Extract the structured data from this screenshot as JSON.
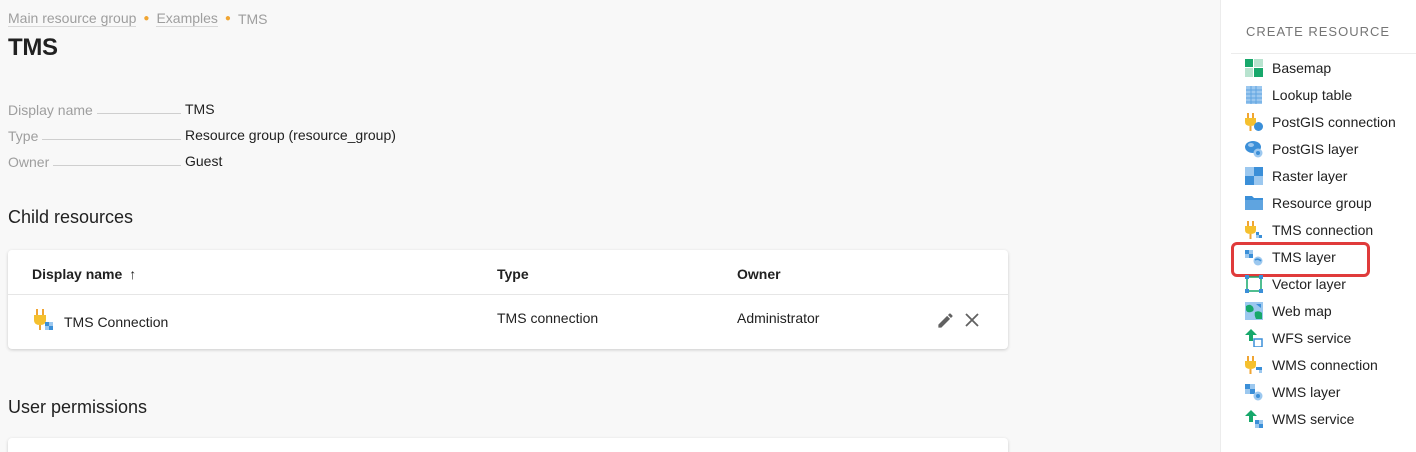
{
  "breadcrumb": [
    "Main resource group",
    "Examples",
    "TMS"
  ],
  "title": "TMS",
  "properties": [
    {
      "key": "Display name",
      "value": "TMS"
    },
    {
      "key": "Type",
      "value": "Resource group (resource_group)"
    },
    {
      "key": "Owner",
      "value": "Guest"
    }
  ],
  "child_resources": {
    "title": "Child resources",
    "columns": {
      "name": "Display name",
      "type": "Type",
      "owner": "Owner"
    },
    "sort_indicator": "↑",
    "rows": [
      {
        "name": "TMS Connection",
        "type": "TMS connection",
        "owner": "Administrator",
        "icon": "tms-connection-icon"
      }
    ]
  },
  "user_permissions": {
    "title": "User permissions"
  },
  "sidebar": {
    "title": "CREATE RESOURCE",
    "items": [
      {
        "label": "Basemap",
        "icon": "basemap-icon"
      },
      {
        "label": "Lookup table",
        "icon": "lookup-table-icon"
      },
      {
        "label": "PostGIS connection",
        "icon": "postgis-connection-icon"
      },
      {
        "label": "PostGIS layer",
        "icon": "postgis-layer-icon"
      },
      {
        "label": "Raster layer",
        "icon": "raster-layer-icon"
      },
      {
        "label": "Resource group",
        "icon": "folder-icon"
      },
      {
        "label": "TMS connection",
        "icon": "tms-connection-icon"
      },
      {
        "label": "TMS layer",
        "icon": "tms-layer-icon",
        "highlighted": true
      },
      {
        "label": "Vector layer",
        "icon": "vector-layer-icon"
      },
      {
        "label": "Web map",
        "icon": "web-map-icon"
      },
      {
        "label": "WFS service",
        "icon": "wfs-service-icon"
      },
      {
        "label": "WMS connection",
        "icon": "wms-connection-icon"
      },
      {
        "label": "WMS layer",
        "icon": "wms-layer-icon"
      },
      {
        "label": "WMS service",
        "icon": "wms-service-icon"
      }
    ]
  },
  "colors": {
    "accent": "#f0a533",
    "highlight": "#e03b3b",
    "green": "#17a86b",
    "blue": "#3b8fd8"
  }
}
